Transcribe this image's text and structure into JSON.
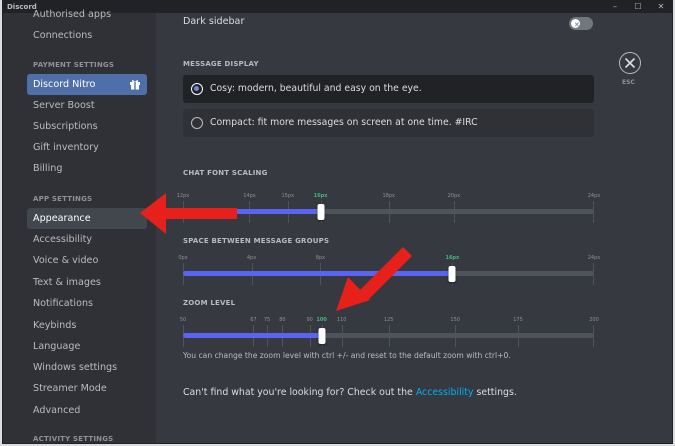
{
  "window": {
    "app_title": "Discord",
    "controls": {
      "minimize": "–",
      "maximize": "☐",
      "close": "✕"
    }
  },
  "sidebar": {
    "top_items": [
      {
        "label": "Authorised apps"
      },
      {
        "label": "Connections"
      }
    ],
    "payment_header": "PAYMENT SETTINGS",
    "payment_items": [
      {
        "label": "Discord Nitro",
        "icon": "gift-icon"
      },
      {
        "label": "Server Boost"
      },
      {
        "label": "Subscriptions"
      },
      {
        "label": "Gift inventory"
      },
      {
        "label": "Billing"
      }
    ],
    "app_header": "APP SETTINGS",
    "app_items": [
      {
        "label": "Appearance",
        "selected": true
      },
      {
        "label": "Accessibility"
      },
      {
        "label": "Voice & video"
      },
      {
        "label": "Text & images"
      },
      {
        "label": "Notifications"
      },
      {
        "label": "Keybinds"
      },
      {
        "label": "Language"
      },
      {
        "label": "Windows settings"
      },
      {
        "label": "Streamer Mode"
      },
      {
        "label": "Advanced"
      }
    ],
    "activity_header": "ACTIVITY SETTINGS"
  },
  "content": {
    "dark_sidebar": {
      "label": "Dark sidebar",
      "enabled": false
    },
    "message_display": {
      "header": "MESSAGE DISPLAY",
      "options": [
        {
          "label": "Cosy: modern, beautiful and easy on the eye.",
          "selected": true
        },
        {
          "label": "Compact: fit more messages on screen at one time. #IRC",
          "selected": false
        }
      ]
    },
    "chat_font_scaling": {
      "header": "CHAT FONT SCALING",
      "ticks": [
        "12px",
        "14px",
        "15px",
        "16px",
        "18px",
        "20px",
        "24px"
      ],
      "tick_values": [
        12,
        14,
        15,
        16,
        18,
        20,
        24
      ],
      "min": 12,
      "max": 24,
      "value": 16,
      "value_label": "16px"
    },
    "message_group_spacing": {
      "header": "SPACE BETWEEN MESSAGE GROUPS",
      "ticks": [
        "0px",
        "4px",
        "8px",
        "16px",
        "24px"
      ],
      "tick_values": [
        0,
        4,
        8,
        16,
        24
      ],
      "min": 0,
      "max": 24,
      "value": 16,
      "value_label": "16px"
    },
    "zoom_level": {
      "header": "ZOOM LEVEL",
      "ticks": [
        "50",
        "67",
        "75",
        "80",
        "90",
        "100",
        "110",
        "125",
        "150",
        "175",
        "200"
      ],
      "tick_values": [
        50,
        67,
        75,
        80,
        90,
        100,
        110,
        125,
        150,
        175,
        200
      ],
      "min": 50,
      "max": 200,
      "value": 100,
      "value_label": "100",
      "hint": "You can change the zoom level with ctrl +/- and reset to the default zoom with ctrl+0."
    },
    "footer": {
      "before": "Can't find what you're looking for? Check out the ",
      "link": "Accessibility",
      "after": " settings."
    },
    "close": {
      "esc_label": "ESC",
      "icon": "close-icon"
    }
  },
  "colors": {
    "accent": "#5865f2",
    "annotation_arrow": "#e8201b",
    "link": "#00aff4",
    "active_tick": "#43b581"
  }
}
